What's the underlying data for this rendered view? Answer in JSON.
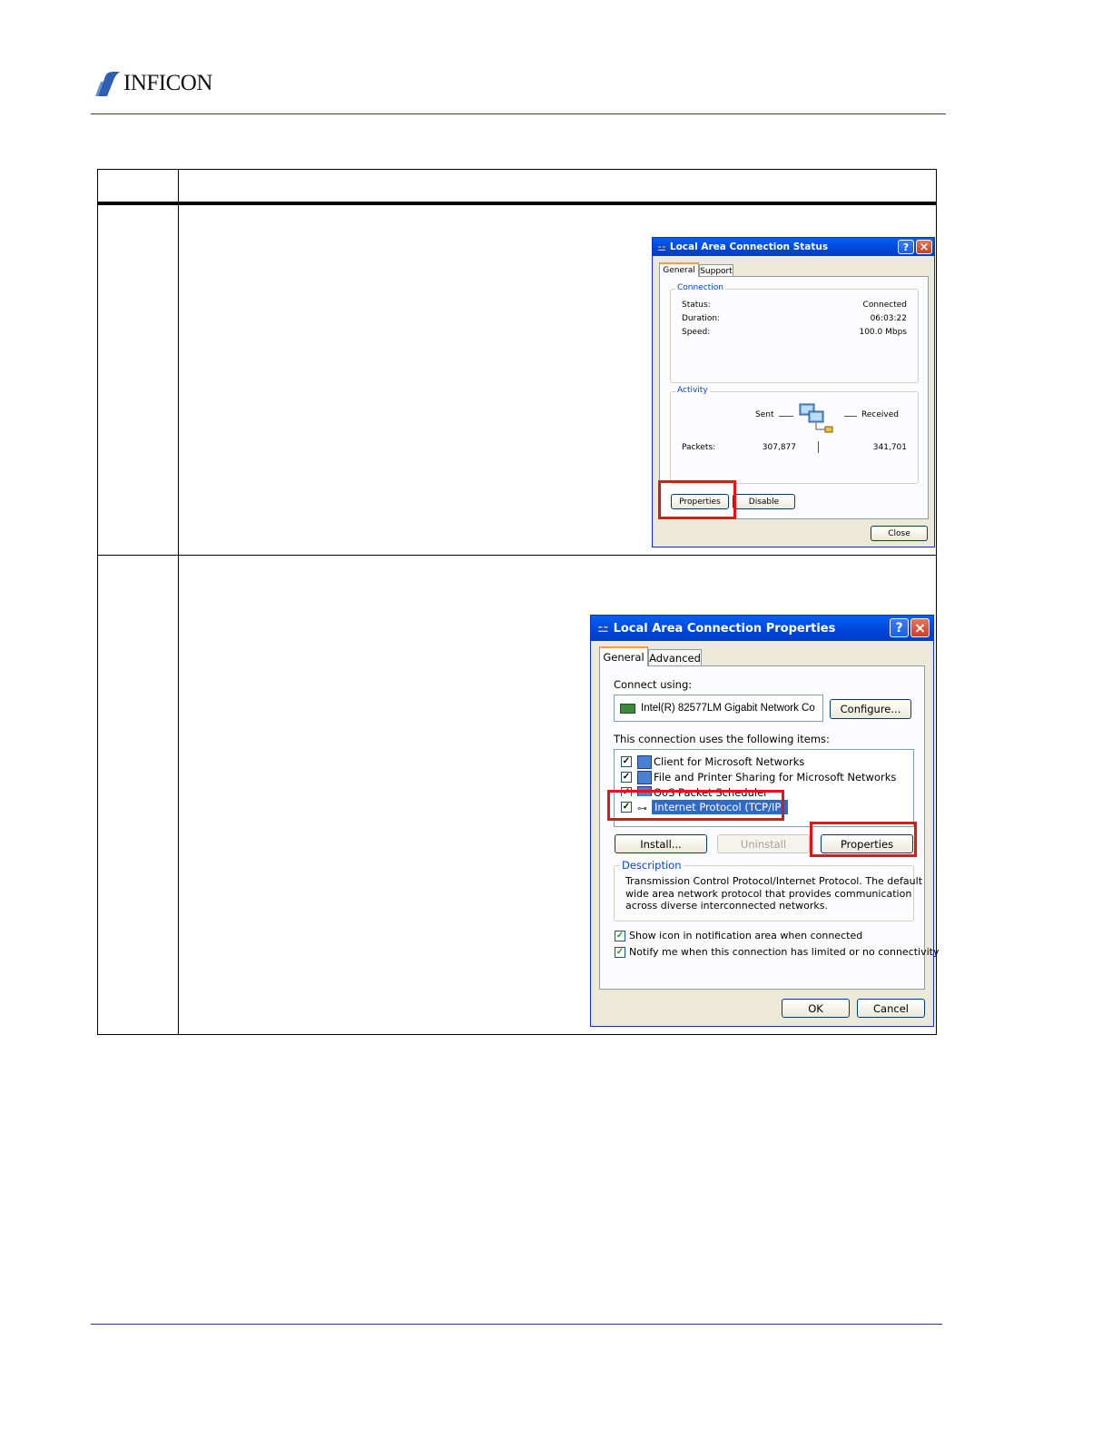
{
  "header": {
    "brand": "INFICON"
  },
  "status_dialog": {
    "title": "Local Area Connection Status",
    "help": "?",
    "close_x": "×",
    "tabs": [
      "General",
      "Support"
    ],
    "connection": {
      "title": "Connection",
      "rows": [
        {
          "label": "Status:",
          "value": "Connected"
        },
        {
          "label": "Duration:",
          "value": "06:03:22"
        },
        {
          "label": "Speed:",
          "value": "100.0 Mbps"
        }
      ]
    },
    "activity": {
      "title": "Activity",
      "sent": "Sent",
      "received": "Received",
      "packets_label": "Packets:",
      "packets_sent": "307,877",
      "packets_received": "341,701"
    },
    "buttons": {
      "properties": "Properties",
      "disable": "Disable",
      "close": "Close"
    }
  },
  "props_dialog": {
    "title": "Local Area Connection Properties",
    "help": "?",
    "close_x": "×",
    "tabs": [
      "General",
      "Advanced"
    ],
    "connect_using_label": "Connect using:",
    "adapter": "Intel(R) 82577LM Gigabit Network Co",
    "configure": "Configure...",
    "items_label": "This connection uses the following items:",
    "items": [
      {
        "label": "Client for Microsoft Networks",
        "icon": "network-client-icon"
      },
      {
        "label": "File and Printer Sharing for Microsoft Networks",
        "icon": "file-sharing-icon"
      },
      {
        "label": "QoS Packet Scheduler",
        "icon": "qos-scheduler-icon"
      },
      {
        "label": "Internet Protocol (TCP/IP)",
        "icon": "protocol-icon"
      }
    ],
    "install": "Install...",
    "uninstall": "Uninstall",
    "properties": "Properties",
    "description_title": "Description",
    "description_lines": [
      "Transmission Control Protocol/Internet Protocol. The default",
      "wide area network protocol that provides communication",
      "across diverse interconnected networks."
    ],
    "show_icon": "Show icon in notification area when connected",
    "notify": "Notify me when this connection has limited or no connectivity",
    "ok": "OK",
    "cancel": "Cancel"
  },
  "colors": {
    "accent_red": "#ee1111",
    "xp_blue": "#0054e3",
    "rule_blue": "#2b3a8c"
  }
}
